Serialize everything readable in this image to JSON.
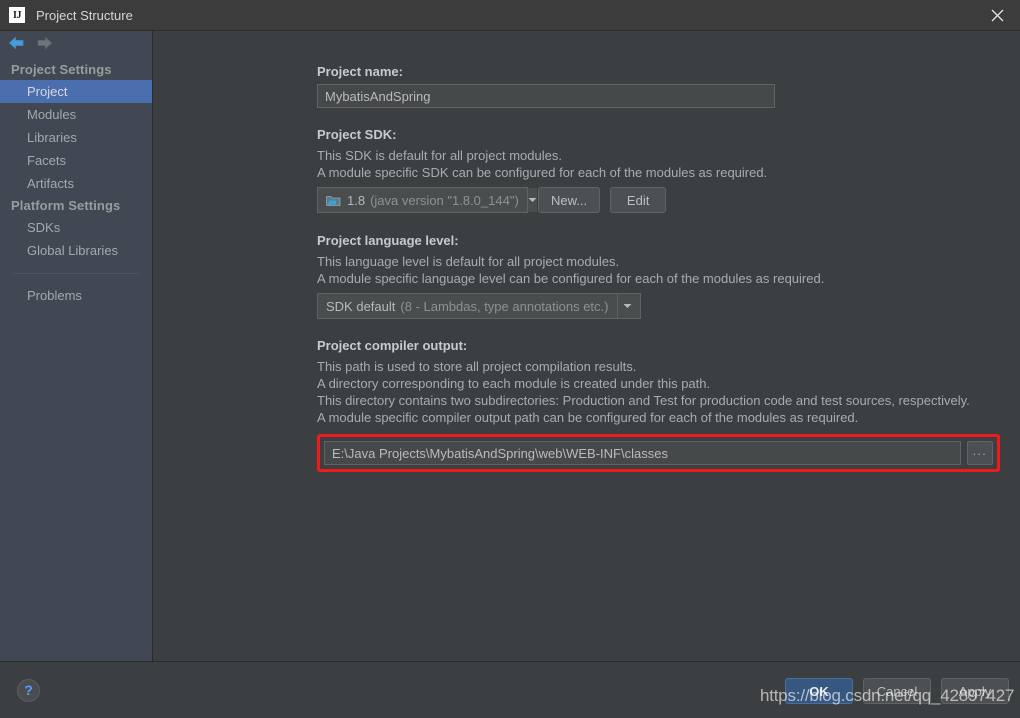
{
  "window": {
    "title": "Project Structure",
    "logo_text": "IJ",
    "close_icon": "close-icon"
  },
  "sidebar": {
    "nav": {
      "back_icon": "arrow-left-icon",
      "forward_icon": "arrow-right-icon"
    },
    "groups": [
      {
        "label": "Project Settings",
        "items": [
          {
            "label": "Project",
            "selected": true
          },
          {
            "label": "Modules",
            "selected": false
          },
          {
            "label": "Libraries",
            "selected": false
          },
          {
            "label": "Facets",
            "selected": false
          },
          {
            "label": "Artifacts",
            "selected": false
          }
        ]
      },
      {
        "label": "Platform Settings",
        "items": [
          {
            "label": "SDKs",
            "selected": false
          },
          {
            "label": "Global Libraries",
            "selected": false
          }
        ]
      }
    ],
    "extra_items": [
      {
        "label": "Problems",
        "selected": false
      }
    ]
  },
  "main": {
    "project_name": {
      "label": "Project name:",
      "value": "MybatisAndSpring"
    },
    "project_sdk": {
      "label": "Project SDK:",
      "desc_line1": "This SDK is default for all project modules.",
      "desc_line2": "A module specific SDK can be configured for each of the modules as required.",
      "icon": "sdk-folder-icon",
      "value_primary": "1.8",
      "value_secondary": "(java version \"1.8.0_144\")",
      "dropdown_icon": "chevron-down-icon",
      "new_button": "New...",
      "edit_button": "Edit"
    },
    "language_level": {
      "label": "Project language level:",
      "desc_line1": "This language level is default for all project modules.",
      "desc_line2": "A module specific language level can be configured for each of the modules as required.",
      "value_primary": "SDK default",
      "value_secondary": "(8 - Lambdas, type annotations etc.)",
      "dropdown_icon": "chevron-down-icon"
    },
    "compiler_output": {
      "label": "Project compiler output:",
      "desc_line1": "This path is used to store all project compilation results.",
      "desc_line2": "A directory corresponding to each module is created under this path.",
      "desc_line3": "This directory contains two subdirectories: Production and Test for production code and test sources, respectively.",
      "desc_line4": "A module specific compiler output path can be configured for each of the modules as required.",
      "value": "E:\\Java Projects\\MybatisAndSpring\\web\\WEB-INF\\classes",
      "browse_button": "...",
      "highlight_color": "#f01a1a"
    }
  },
  "footer": {
    "help_icon": "question-mark-icon",
    "ok_button": "OK",
    "cancel_button": "Cancel",
    "apply_button": "Apply"
  },
  "overlay": {
    "watermark": "https://blog.csdn.net/qq_42897427"
  },
  "colors": {
    "window_bg": "#3c3f41",
    "sidebar_bg": "#414753",
    "titlebar_bg": "#3c3c3c",
    "selection": "#4b6eaf",
    "primary_button": "#365880",
    "accent_blue": "#589df6",
    "highlight_red": "#f01a1a"
  }
}
